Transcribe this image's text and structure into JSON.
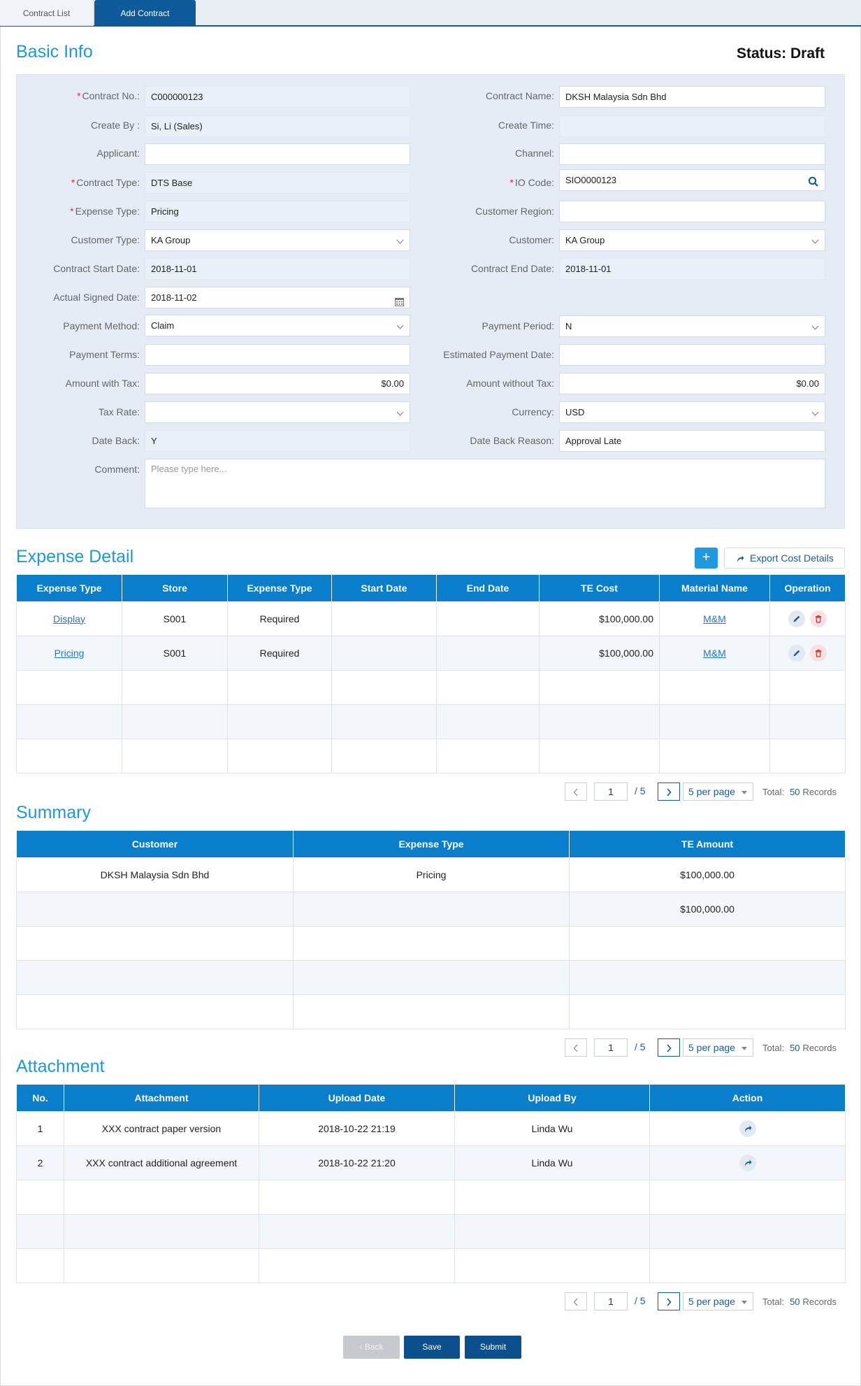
{
  "tabs": [
    {
      "label": "Contract List"
    },
    {
      "label": "Add Contract"
    }
  ],
  "basic_info": {
    "title": "Basic Info",
    "status_label": "Status: Draft",
    "fields": {
      "contract_no": {
        "label": "Contract No.:",
        "value": "C000000123"
      },
      "contract_name": {
        "label": "Contract Name:",
        "value": "DKSH Malaysia Sdn Bhd"
      },
      "create_by": {
        "label": "Create By :",
        "value": "Si, Li (Sales)"
      },
      "create_time": {
        "label": "Create Time:",
        "value": ""
      },
      "applicant": {
        "label": "Applicant:",
        "value": ""
      },
      "channel": {
        "label": "Channel:",
        "value": ""
      },
      "contract_type": {
        "label": "Contract Type:",
        "value": "DTS Base"
      },
      "io_code": {
        "label": "IO Code:",
        "value": "SIO0000123"
      },
      "expense_type": {
        "label": "Expense Type:",
        "value": "Pricing"
      },
      "customer_region": {
        "label": "Customer Region:",
        "value": ""
      },
      "customer_type": {
        "label": "Customer Type:",
        "value": "KA Group"
      },
      "customer": {
        "label": "Customer:",
        "value": "KA Group"
      },
      "contract_start_date": {
        "label": "Contract Start Date:",
        "value": "2018-11-01"
      },
      "contract_end_date": {
        "label": "Contract End Date:",
        "value": "2018-11-01"
      },
      "actual_signed_date": {
        "label": "Actual Signed Date:",
        "value": "2018-11-02"
      },
      "payment_method": {
        "label": "Payment Method:",
        "value": "Claim"
      },
      "payment_period": {
        "label": "Payment Period:",
        "value": "N"
      },
      "payment_terms": {
        "label": "Payment Terms:",
        "value": ""
      },
      "estimated_payment_date": {
        "label": "Estimated Payment Date:",
        "value": ""
      },
      "amount_with_tax": {
        "label": "Amount with Tax:",
        "value": "$0.00"
      },
      "amount_without_tax": {
        "label": "Amount without Tax:",
        "value": "$0.00"
      },
      "tax_rate": {
        "label": "Tax Rate:",
        "value": ""
      },
      "currency": {
        "label": "Currency:",
        "value": "USD"
      },
      "date_back": {
        "label": "Date Back:",
        "value": "Y"
      },
      "date_back_reason": {
        "label": "Date Back Reason:",
        "value": "Approval Late"
      },
      "comment": {
        "label": "Comment:",
        "placeholder": "Please type here..."
      }
    }
  },
  "expense_detail": {
    "title": "Expense Detail",
    "add_label": "+",
    "export_label": "Export Cost Details",
    "columns": [
      "Expense Type",
      "Store",
      "Expense Type",
      "Start Date",
      "End Date",
      "TE Cost",
      "Material Name",
      "Operation"
    ],
    "rows": [
      {
        "expense_type": "Display",
        "store": "S001",
        "expense_type2": "Required",
        "start": "",
        "end": "",
        "te_cost": "$100,000.00",
        "material": "M&M"
      },
      {
        "expense_type": "Pricing",
        "store": "S001",
        "expense_type2": "Required",
        "start": "",
        "end": "",
        "te_cost": "$100,000.00",
        "material": "M&M"
      }
    ],
    "pager": {
      "page": "1",
      "of": "/ 5",
      "per_page": "5 per page",
      "total_label": "Total:",
      "total": "50",
      "records_label": "Records"
    }
  },
  "summary": {
    "title": "Summary",
    "columns": [
      "Customer",
      "Expense Type",
      "TE Amount"
    ],
    "rows": [
      {
        "customer": "DKSH Malaysia Sdn Bhd",
        "expense_type": "Pricing",
        "amount": "$100,000.00"
      },
      {
        "customer": "",
        "expense_type": "",
        "amount": "$100,000.00"
      }
    ],
    "pager": {
      "page": "1",
      "of": "/ 5",
      "per_page": "5 per page",
      "total_label": "Total:",
      "total": "50",
      "records_label": "Records"
    }
  },
  "attachment": {
    "title": "Attachment",
    "columns": [
      "No.",
      "Attachment",
      "Upload Date",
      "Upload By",
      "Action"
    ],
    "rows": [
      {
        "no": "1",
        "name": "XXX contract paper version",
        "date": "2018-10-22 21:19",
        "by": "Linda Wu"
      },
      {
        "no": "2",
        "name": "XXX contract additional agreement",
        "date": "2018-10-22 21:20",
        "by": "Linda Wu"
      }
    ],
    "pager": {
      "page": "1",
      "of": "/ 5",
      "per_page": "5 per page",
      "total_label": "Total:",
      "total": "50",
      "records_label": "Records"
    }
  },
  "footer": {
    "back_label": "‹ Back",
    "save_label": "Save",
    "submit_label": "Submit"
  },
  "colors": {
    "accent": "#1a9ad8",
    "header_blue": "#0a7ecb",
    "dark_blue": "#0b4f8c",
    "required": "#e0302d"
  }
}
